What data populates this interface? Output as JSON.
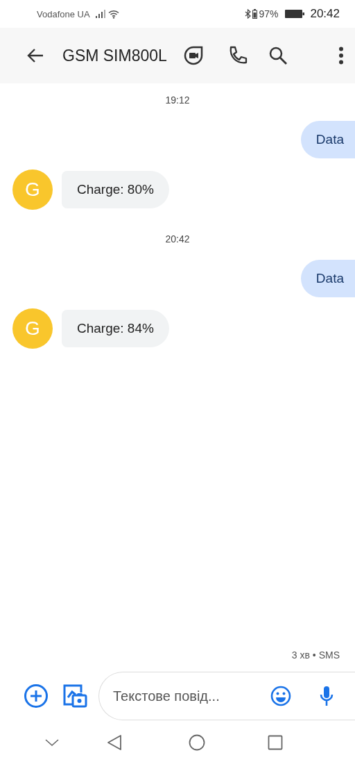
{
  "status_bar": {
    "carrier": "Vodafone UA",
    "battery_percent": "97%",
    "time": "20:42"
  },
  "app_bar": {
    "title": "GSM SIM800L"
  },
  "messages": [
    {
      "kind": "timestamp",
      "text": "19:12"
    },
    {
      "kind": "outgoing",
      "text": "Data"
    },
    {
      "kind": "incoming",
      "avatar": "G",
      "text": "Charge: 80%"
    },
    {
      "kind": "timestamp",
      "text": "20:42"
    },
    {
      "kind": "outgoing",
      "text": "Data"
    },
    {
      "kind": "incoming",
      "avatar": "G",
      "text": "Charge: 84%"
    }
  ],
  "delivery_info": "3 хв • SMS",
  "composer": {
    "placeholder": "Текстове повід..."
  }
}
